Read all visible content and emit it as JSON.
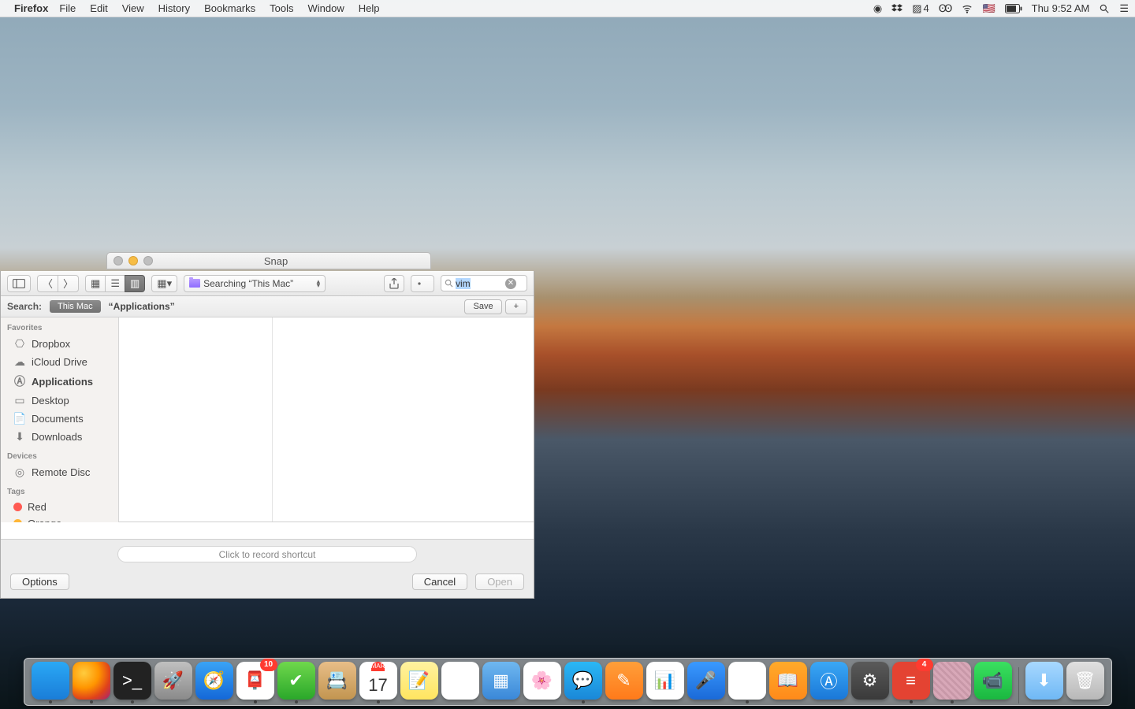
{
  "menubar": {
    "app": "Firefox",
    "items": [
      "File",
      "Edit",
      "View",
      "History",
      "Bookmarks",
      "Tools",
      "Window",
      "Help"
    ],
    "status": {
      "sync_count": "4",
      "day_time": "Thu 9:52 AM"
    }
  },
  "snap_window": {
    "title": "Snap"
  },
  "dialog": {
    "path_label": "Searching “This Mac”",
    "search_value": "vim",
    "scope": {
      "label": "Search:",
      "active": "This Mac",
      "other": "“Applications”",
      "save": "Save",
      "plus": "+"
    },
    "sidebar": {
      "favorites_label": "Favorites",
      "favorites": [
        "Dropbox",
        "iCloud Drive",
        "Applications",
        "Desktop",
        "Documents",
        "Downloads"
      ],
      "devices_label": "Devices",
      "devices": [
        "Remote Disc"
      ],
      "tags_label": "Tags",
      "tags": [
        {
          "name": "Red",
          "cls": "tag-red"
        },
        {
          "name": "Orange",
          "cls": "tag-orange"
        }
      ]
    },
    "shortcut_placeholder": "Click to record shortcut",
    "buttons": {
      "options": "Options",
      "cancel": "Cancel",
      "open": "Open"
    }
  },
  "dock": {
    "apps": [
      {
        "name": "finder",
        "cls": "i-finder",
        "glyph": "",
        "running": true
      },
      {
        "name": "firefox",
        "cls": "i-firefox",
        "glyph": "",
        "running": true
      },
      {
        "name": "terminal",
        "cls": "i-term",
        "glyph": ">_",
        "running": true
      },
      {
        "name": "launchpad",
        "cls": "i-launch",
        "glyph": "🚀",
        "running": false
      },
      {
        "name": "safari",
        "cls": "i-safari",
        "glyph": "🧭",
        "running": false
      },
      {
        "name": "mail",
        "cls": "i-mail",
        "glyph": "📮",
        "running": true,
        "badge": "10"
      },
      {
        "name": "macvim",
        "cls": "i-macvim",
        "glyph": "✔︎",
        "running": true
      },
      {
        "name": "contacts",
        "cls": "i-contacts",
        "glyph": "📇",
        "running": false
      },
      {
        "name": "calendar",
        "cls": "cal-tile",
        "glyph": "",
        "running": true,
        "cal_month": "MAR",
        "cal_day": "17"
      },
      {
        "name": "notes",
        "cls": "i-notes",
        "glyph": "📝",
        "running": false
      },
      {
        "name": "reminders",
        "cls": "i-rem",
        "glyph": "▤",
        "running": false
      },
      {
        "name": "keynote-alt",
        "cls": "i-keynote-alt",
        "glyph": "▦",
        "running": false
      },
      {
        "name": "photos",
        "cls": "i-photos",
        "glyph": "🌸",
        "running": false
      },
      {
        "name": "messages",
        "cls": "i-messages",
        "glyph": "💬",
        "running": true
      },
      {
        "name": "pages",
        "cls": "i-pages",
        "glyph": "✎",
        "running": false
      },
      {
        "name": "numbers",
        "cls": "i-numbers",
        "glyph": "📊",
        "running": false
      },
      {
        "name": "keynote",
        "cls": "i-keynote",
        "glyph": "🎤",
        "running": false
      },
      {
        "name": "itunes",
        "cls": "i-itunes",
        "glyph": "♫",
        "running": true
      },
      {
        "name": "ibooks",
        "cls": "i-ibooks",
        "glyph": "📖",
        "running": false
      },
      {
        "name": "appstore",
        "cls": "i-appstore",
        "glyph": "Ⓐ",
        "running": false
      },
      {
        "name": "system-preferences",
        "cls": "i-sys",
        "glyph": "⚙︎",
        "running": false
      },
      {
        "name": "todoist",
        "cls": "i-todoist",
        "glyph": "≡",
        "running": true,
        "badge": "4"
      },
      {
        "name": "missing",
        "cls": "i-miss",
        "glyph": "",
        "running": true
      },
      {
        "name": "facetime",
        "cls": "i-ft",
        "glyph": "📹",
        "running": false
      }
    ],
    "right": [
      {
        "name": "downloads",
        "cls": "i-dl",
        "glyph": "⬇︎"
      },
      {
        "name": "trash",
        "cls": "i-trash",
        "glyph": "🗑"
      }
    ]
  }
}
